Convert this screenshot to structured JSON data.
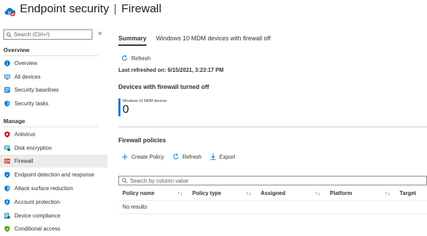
{
  "header": {
    "title_main": "Endpoint security",
    "title_separator": "|",
    "title_sub": "Firewall",
    "more_label": "···"
  },
  "sidebar": {
    "search_placeholder": "Search (Ctrl+/)",
    "collapse_glyph": "«",
    "overview_section": "Overview",
    "manage_section": "Manage",
    "items": [
      {
        "label": "Overview",
        "icon": "info-icon"
      },
      {
        "label": "All devices",
        "icon": "devices-icon"
      },
      {
        "label": "Security baselines",
        "icon": "baseline-icon"
      },
      {
        "label": "Security tasks",
        "icon": "shield-tasks-icon"
      },
      {
        "label": "Antivirus",
        "icon": "antivirus-shield-icon"
      },
      {
        "label": "Disk encryption",
        "icon": "disk-encryption-icon"
      },
      {
        "label": "Firewall",
        "icon": "firewall-icon"
      },
      {
        "label": "Endpoint detection and response",
        "icon": "edr-shield-icon"
      },
      {
        "label": "Attack surface reduction",
        "icon": "asr-shield-icon"
      },
      {
        "label": "Account protection",
        "icon": "account-protection-icon"
      },
      {
        "label": "Device compliance",
        "icon": "device-compliance-icon"
      },
      {
        "label": "Conditional access",
        "icon": "conditional-access-icon"
      }
    ]
  },
  "main": {
    "tabs": [
      {
        "label": "Summary",
        "active": true
      },
      {
        "label": "Windows 10 MDM devices with firewall off",
        "active": false
      }
    ],
    "refresh_label": "Refresh",
    "last_refreshed": "Last refreshed on: 6/15/2021, 3:23:17 PM",
    "devices_heading": "Devices with firewall turned off",
    "tile": {
      "label": "Windows 10 MDM devices",
      "value": "0"
    },
    "policies_heading": "Firewall policies",
    "toolbar": {
      "create_label": "Create Policy",
      "refresh_label": "Refresh",
      "export_label": "Export"
    },
    "filter_placeholder": "Search by column value",
    "columns": [
      "Policy name",
      "Policy type",
      "Assigned",
      "Platform",
      "Target"
    ],
    "sort_glyph": "↑↓",
    "no_results": "No results"
  },
  "colors": {
    "accent": "#0078d4",
    "text": "#323130",
    "active_nav_bg": "#edebe9"
  }
}
